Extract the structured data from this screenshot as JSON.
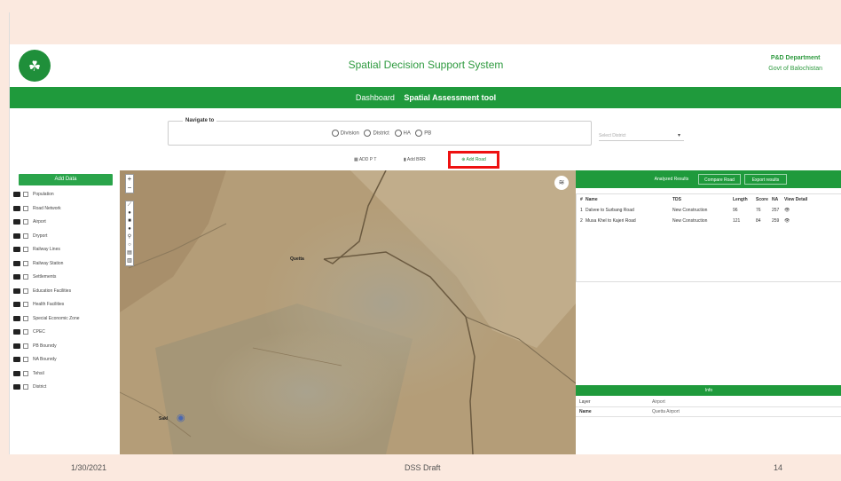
{
  "app": {
    "title": "Spatial Decision Support System",
    "dept_line1": "P&D Department",
    "dept_line2": "Govt of Balochistan"
  },
  "nav": {
    "dashboard": "Dashboard",
    "assessment": "Spatial Assessment tool"
  },
  "navigate": {
    "legend": "Navigate to",
    "options": [
      "Division",
      "District",
      "HA",
      "PB"
    ],
    "select_placeholder": "Select District"
  },
  "tools": {
    "t1": "ADD P T",
    "t2": "Add BRR",
    "t3": "Add Road"
  },
  "sidebar": {
    "add_button": "Add Data",
    "layers": [
      "Population",
      "Road Network",
      "Airport",
      "Dryport",
      "Railway Lines",
      "Railway Station",
      "Settlements",
      "Education Facilities",
      "Health Facilities",
      "Special Economic Zone",
      "CPEC",
      "PB Bounrdy",
      "NA Bounrdy",
      "Tehsil",
      "District"
    ]
  },
  "map": {
    "label_city": "Quetta",
    "label_pin": "Sakl"
  },
  "results": {
    "tabs": [
      "Analyzed Results",
      "Compare Road",
      "Export results"
    ],
    "headers": [
      "#",
      "Name",
      "TDS",
      "Length",
      "Score",
      "NA",
      "View Detail"
    ],
    "rows": [
      [
        "1",
        "Dalvee to Surbang Road",
        "New Construction",
        "96",
        "76",
        "257",
        "👁"
      ],
      [
        "2",
        "Musa Khel to Kajeri Road",
        "New Construction",
        "121",
        "84",
        "259",
        "👁"
      ]
    ]
  },
  "info": {
    "title": "Info",
    "rows": [
      {
        "k": "Layer",
        "v": "Airport"
      },
      {
        "k": "Name",
        "v": "Quetta Airport"
      }
    ]
  },
  "footer": {
    "date": "1/30/2021",
    "center": "DSS Draft",
    "page": "14"
  },
  "colors": {
    "brand_green": "#1f9a3c",
    "highlight_red": "#e11111",
    "slide_bg": "#fbe9df"
  }
}
